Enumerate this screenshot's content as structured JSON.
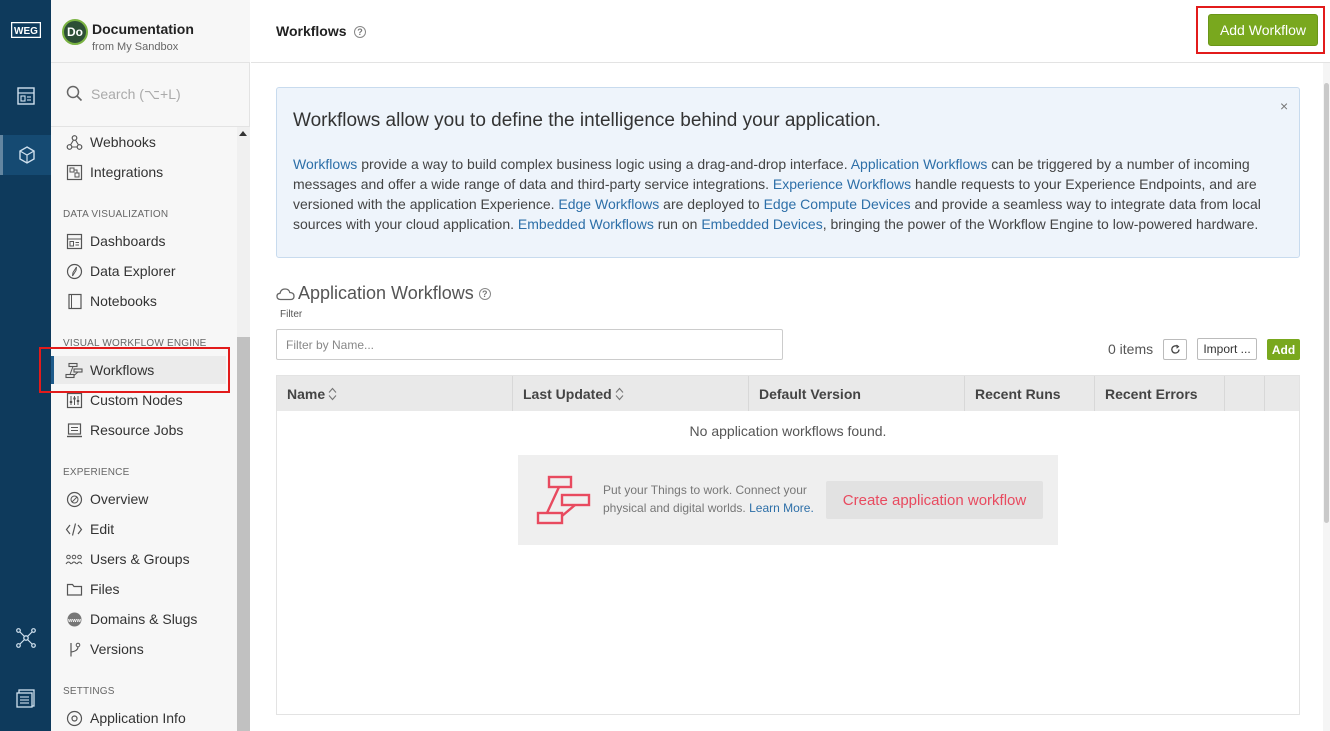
{
  "rail": {
    "logo_text": "WEG",
    "items": [
      {
        "icon": "dashboard-grid-icon"
      },
      {
        "icon": "cube-icon",
        "active": true
      },
      {
        "icon": "network-icon"
      },
      {
        "icon": "building-icon"
      }
    ]
  },
  "app": {
    "avatar": "Do",
    "name": "Documentation",
    "subtitle": "from My Sandbox"
  },
  "search": {
    "placeholder": "Search (⌥+L)"
  },
  "sidebar": {
    "items": [
      {
        "label": "Webhooks",
        "icon": "webhook-icon"
      },
      {
        "label": "Integrations",
        "icon": "integrations-icon"
      },
      {
        "label": "Dashboards",
        "icon": "dashboard-icon"
      },
      {
        "label": "Data Explorer",
        "icon": "compass-icon"
      },
      {
        "label": "Notebooks",
        "icon": "notebook-icon"
      },
      {
        "label": "Workflows",
        "icon": "workflow-icon",
        "active": true
      },
      {
        "label": "Custom Nodes",
        "icon": "sliders-icon"
      },
      {
        "label": "Resource Jobs",
        "icon": "jobs-icon"
      },
      {
        "label": "Overview",
        "icon": "overview-icon"
      },
      {
        "label": "Edit",
        "icon": "code-icon"
      },
      {
        "label": "Users & Groups",
        "icon": "users-icon"
      },
      {
        "label": "Files",
        "icon": "folder-icon"
      },
      {
        "label": "Domains & Slugs",
        "icon": "globe-icon"
      },
      {
        "label": "Versions",
        "icon": "branch-icon"
      },
      {
        "label": "Application Info",
        "icon": "gear-icon"
      }
    ],
    "sections": {
      "data_viz": "DATA VISUALIZATION",
      "vwe": "VISUAL WORKFLOW ENGINE",
      "experience": "EXPERIENCE",
      "settings": "SETTINGS"
    }
  },
  "header": {
    "title": "Workflows",
    "help": "?",
    "add_workflow": "Add Workflow"
  },
  "info": {
    "title": "Workflows allow you to define the intelligence behind your application.",
    "close": "×",
    "parts": [
      {
        "t": "Workflows",
        "link": true
      },
      {
        "t": " provide a way to build complex business logic using a drag-and-drop interface. "
      },
      {
        "t": "Application Workflows",
        "link": true
      },
      {
        "t": " can be triggered by a number of incoming messages and offer a wide range of data and third-party service integrations. "
      },
      {
        "t": "Experience Workflows",
        "link": true
      },
      {
        "t": " handle requests to your Experience Endpoints, and are versioned with the application Experience. "
      },
      {
        "t": "Edge Workflows",
        "link": true
      },
      {
        "t": " are deployed to "
      },
      {
        "t": "Edge Compute Devices",
        "link": true
      },
      {
        "t": " and provide a seamless way to integrate data from local sources with your cloud application. "
      },
      {
        "t": "Embedded Workflows",
        "link": true
      },
      {
        "t": " run on "
      },
      {
        "t": "Embedded Devices",
        "link": true
      },
      {
        "t": ", bringing the power of the Workflow Engine to low-powered hardware."
      }
    ]
  },
  "workflows_section": {
    "title": "Application Workflows",
    "filter_label": "Filter",
    "filter_placeholder": "Filter by Name...",
    "items_count": "0 items",
    "import_label": "Import ...",
    "add_label": "Add",
    "columns": [
      "Name",
      "Last Updated",
      "Default Version",
      "Recent Runs",
      "Recent Errors"
    ],
    "empty_message": "No application workflows found.",
    "empty_card": {
      "text": "Put your Things to work. Connect your physical and digital worlds.",
      "link": "Learn More.",
      "button": "Create application workflow"
    }
  },
  "colors": {
    "rail": "#0e3a5c",
    "accent_green": "#79a81e",
    "link": "#2d6fa8",
    "highlight": "#e21b1b",
    "create_text": "#e84a5f"
  }
}
